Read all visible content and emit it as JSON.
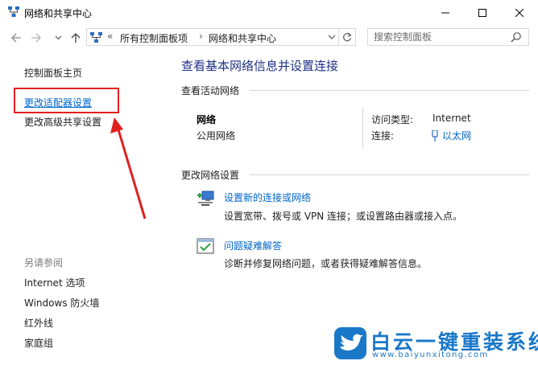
{
  "window": {
    "title": "网络和共享中心",
    "controls": {
      "minimize": "minimize-icon",
      "maximize": "maximize-icon",
      "close": "close-icon"
    }
  },
  "nav": {
    "back": "back-arrow-icon",
    "forward": "forward-arrow-icon",
    "history": "chevron-down-icon",
    "up": "up-arrow-icon",
    "address": {
      "overflow": "«",
      "crumbs": [
        "所有控制面板项",
        "网络和共享中心"
      ],
      "separator": "›"
    },
    "refresh": "refresh-icon",
    "search_placeholder": "搜索控制面板"
  },
  "sidebar": {
    "home": "控制面板主页",
    "change_adapter": "更改适配器设置",
    "change_sharing": "更改高级共享设置",
    "see_also_heading": "另请参阅",
    "see_also": [
      "Internet 选项",
      "Windows 防火墙",
      "红外线",
      "家庭组"
    ]
  },
  "main": {
    "title": "查看基本网络信息并设置连接",
    "active_section": "查看活动网络",
    "network": {
      "name": "网络",
      "type": "公用网络",
      "access_type_label": "访问类型:",
      "access_type_value": "Internet",
      "connections_label": "连接:",
      "connections_value": "以太网"
    },
    "change_section": "更改网络设置",
    "tasks": [
      {
        "title": "设置新的连接或网络",
        "desc": "设置宽带、拨号或 VPN 连接；或设置路由器或接入点。",
        "icon": "new-connection-icon"
      },
      {
        "title": "问题疑难解答",
        "desc": "诊断并修复网络问题，或者获得疑难解答信息。",
        "icon": "troubleshoot-icon"
      }
    ]
  },
  "annotation": {
    "color": "#e02020"
  },
  "watermark": {
    "name": "白云一键重装系统",
    "url": "www.baiyunxitong.com"
  },
  "colors": {
    "link": "#0066cc",
    "title": "#1e3287",
    "brand": "#1a78c8"
  }
}
